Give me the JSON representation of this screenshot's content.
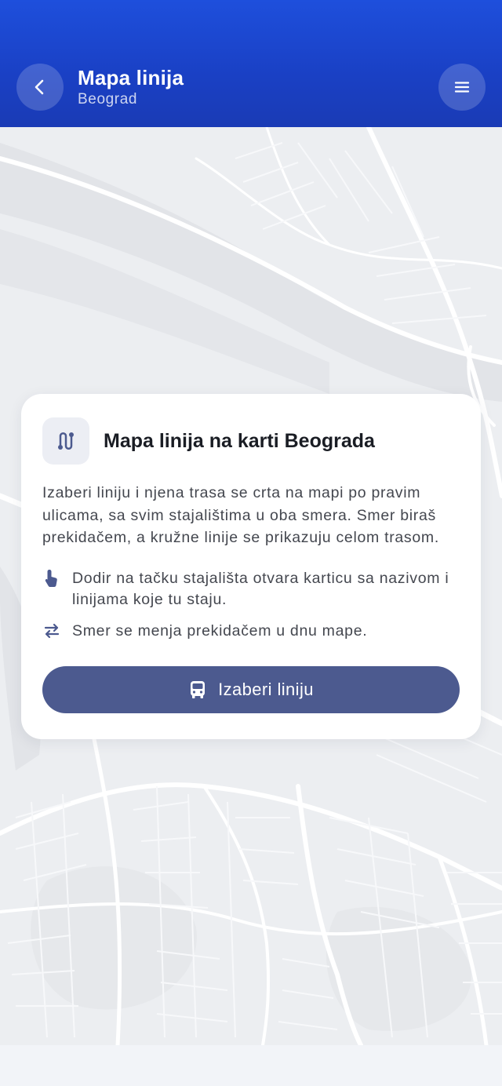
{
  "header": {
    "title": "Mapa linija",
    "subtitle": "Beograd",
    "back_icon": "chevron-left-icon",
    "menu_icon": "hamburger-menu-icon",
    "gradient_top": "#1e4fdc",
    "gradient_bottom": "#1a3bb5"
  },
  "card": {
    "icon": "route-icon",
    "title": "Mapa linija na karti Beograda",
    "description": "Izaberi liniju i njena trasa se crta na mapi po pravim ulicama, sa svim stajalištima u oba smera. Smer biraš prekidačem, a kružne linije se prikazuju celom trasom.",
    "tips": [
      {
        "icon": "tap-hand-icon",
        "text": "Dodir na tačku stajališta otvara karticu sa nazivom i linijama koje tu staju."
      },
      {
        "icon": "swap-arrows-icon",
        "text": "Smer se menja prekidačem u dnu mape."
      }
    ],
    "button": {
      "label": "Izaberi liniju",
      "icon": "bus-icon",
      "color": "#4c5a8f"
    }
  },
  "map": {
    "background": "#eceef1",
    "water_color": "#dfe1e5",
    "road_color": "#ffffff"
  }
}
